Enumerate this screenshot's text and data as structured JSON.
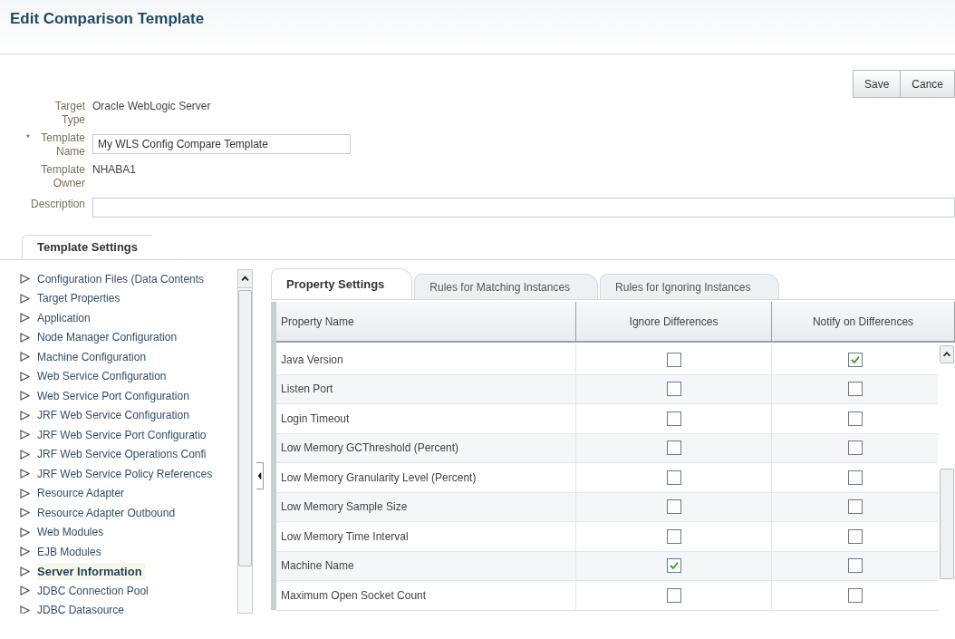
{
  "page_title": "Edit Comparison Template",
  "buttons": [
    {
      "label": "Save"
    },
    {
      "label": "Cance"
    }
  ],
  "form": [
    {
      "label": "Target Type",
      "kind": "text",
      "value": "Oracle WebLogic Server"
    },
    {
      "label": "Template Name",
      "kind": "input",
      "value": "My WLS Config Compare Template",
      "marker": "*"
    },
    {
      "label": "Template Owner",
      "kind": "text",
      "value": "NHABA1"
    },
    {
      "label": "Description",
      "kind": "input"
    }
  ],
  "settings_tab": "Template Settings",
  "tree": [
    {
      "label": "Configuration Files (Data Contents",
      "selected": false
    },
    {
      "label": "Target Properties",
      "selected": false
    },
    {
      "label": "Application",
      "selected": false
    },
    {
      "label": "Node Manager Configuration",
      "selected": false
    },
    {
      "label": "Machine Configuration",
      "selected": false
    },
    {
      "label": "Web Service Configuration",
      "selected": false
    },
    {
      "label": "Web Service Port Configuration",
      "selected": false
    },
    {
      "label": "JRF Web Service Configuration",
      "selected": false
    },
    {
      "label": "JRF Web Service Port Configuratio",
      "selected": false
    },
    {
      "label": "JRF Web Service Operations Confi",
      "selected": false
    },
    {
      "label": "JRF Web Service Policy References",
      "selected": false
    },
    {
      "label": "Resource Adapter",
      "selected": false
    },
    {
      "label": "Resource Adapter Outbound",
      "selected": false
    },
    {
      "label": "Web Modules",
      "selected": false
    },
    {
      "label": "EJB Modules",
      "selected": false
    },
    {
      "label": "Server Information",
      "selected": true
    },
    {
      "label": "JDBC Connection Pool",
      "selected": false
    },
    {
      "label": "JDBC Datasource",
      "selected": false
    }
  ],
  "tabs": [
    {
      "label": "Property Settings",
      "selected": true
    },
    {
      "label": "Rules for Matching Instances",
      "selected": false
    },
    {
      "label": "Rules for Ignoring Instances",
      "selected": false
    }
  ],
  "table": {
    "columns": [
      "Property Name",
      "Ignore Differences",
      "Notify on Differences"
    ],
    "rows": [
      {
        "name": "Java Version",
        "ignore": false,
        "notify": true
      },
      {
        "name": "Listen Port",
        "ignore": false,
        "notify": false
      },
      {
        "name": "Login Timeout",
        "ignore": false,
        "notify": false
      },
      {
        "name": "Low Memory GCThreshold (Percent)",
        "ignore": false,
        "notify": false
      },
      {
        "name": "Low Memory Granularity Level (Percent)",
        "ignore": false,
        "notify": false
      },
      {
        "name": "Low Memory Sample Size",
        "ignore": false,
        "notify": false
      },
      {
        "name": "Low Memory Time Interval",
        "ignore": false,
        "notify": false
      },
      {
        "name": "Machine Name",
        "ignore": true,
        "notify": false
      },
      {
        "name": "Maximum Open Socket Count",
        "ignore": false,
        "notify": false
      }
    ]
  }
}
